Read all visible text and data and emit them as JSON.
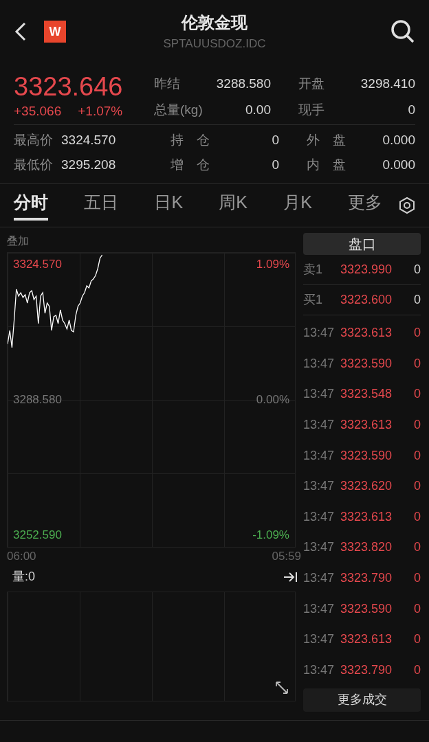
{
  "header": {
    "title": "伦敦金现",
    "code": "SPTAUUSDOZ.IDC",
    "logo": "W"
  },
  "quote": {
    "price": "3323.646",
    "change": "+35.066",
    "change_pct": "+1.07%",
    "stats": [
      {
        "label": "昨结",
        "value": "3288.580"
      },
      {
        "label": "开盘",
        "value": "3298.410"
      },
      {
        "label": "总量(kg)",
        "value": "0.00"
      },
      {
        "label": "现手",
        "value": "0"
      }
    ],
    "stats2": [
      {
        "label": "最高价",
        "value": "3324.570"
      },
      {
        "label": "持　仓",
        "value": "0"
      },
      {
        "label": "外　盘",
        "value": "0.000"
      },
      {
        "label": "最低价",
        "value": "3295.208"
      },
      {
        "label": "增　仓",
        "value": "0"
      },
      {
        "label": "内　盘",
        "value": "0.000"
      }
    ]
  },
  "tabs": [
    {
      "label": "分时",
      "selected": true
    },
    {
      "label": "五日",
      "selected": false
    },
    {
      "label": "日K",
      "selected": false
    },
    {
      "label": "周K",
      "selected": false
    },
    {
      "label": "月K",
      "selected": false
    },
    {
      "label": "更多",
      "selected": false
    }
  ],
  "chart": {
    "overlay": "叠加",
    "high": "3324.570",
    "high_pct": "1.09%",
    "mid": "3288.580",
    "mid_pct": "0.00%",
    "low": "3252.590",
    "low_pct": "-1.09%",
    "start": "06:00",
    "end": "05:59",
    "volume": "量:0"
  },
  "book": {
    "title": "盘口",
    "levels": [
      {
        "label": "卖1",
        "price": "3323.990",
        "qty": "0"
      },
      {
        "label": "买1",
        "price": "3323.600",
        "qty": "0"
      }
    ],
    "trades": [
      {
        "time": "13:47",
        "price": "3323.613",
        "qty": "0"
      },
      {
        "time": "13:47",
        "price": "3323.590",
        "qty": "0"
      },
      {
        "time": "13:47",
        "price": "3323.548",
        "qty": "0"
      },
      {
        "time": "13:47",
        "price": "3323.613",
        "qty": "0"
      },
      {
        "time": "13:47",
        "price": "3323.590",
        "qty": "0"
      },
      {
        "time": "13:47",
        "price": "3323.620",
        "qty": "0"
      },
      {
        "time": "13:47",
        "price": "3323.613",
        "qty": "0"
      },
      {
        "time": "13:47",
        "price": "3323.820",
        "qty": "0"
      },
      {
        "time": "13:47",
        "price": "3323.790",
        "qty": "0"
      },
      {
        "time": "13:47",
        "price": "3323.590",
        "qty": "0"
      },
      {
        "time": "13:47",
        "price": "3323.613",
        "qty": "0"
      },
      {
        "time": "13:47",
        "price": "3323.790",
        "qty": "0"
      }
    ],
    "more": "更多成交"
  }
}
